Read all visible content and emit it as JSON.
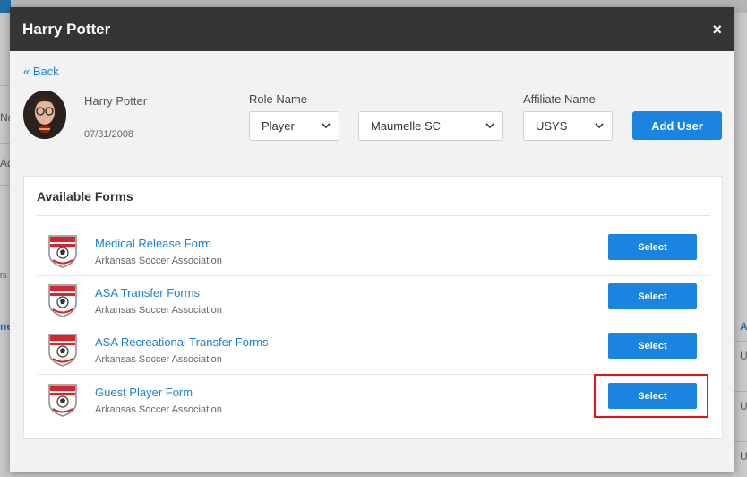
{
  "background_fragments": [
    "Na",
    "Ad",
    "rs",
    "ne",
    "A",
    "U",
    "U",
    "U"
  ],
  "modal": {
    "title": "Harry Potter",
    "close_icon": "×"
  },
  "back_link": "« Back",
  "user": {
    "name": "Harry Potter",
    "dob": "07/31/2008"
  },
  "fields": {
    "role_label": "Role Name",
    "role_value": "Player",
    "club_value": "Maumelle SC",
    "affiliate_label": "Affiliate Name",
    "affiliate_value": "USYS"
  },
  "add_user_label": "Add User",
  "forms": {
    "title": "Available Forms",
    "items": [
      {
        "name": "Medical Release Form",
        "org": "Arkansas Soccer Association",
        "button": "Select"
      },
      {
        "name": "ASA Transfer Forms",
        "org": "Arkansas Soccer Association",
        "button": "Select"
      },
      {
        "name": "ASA Recreational Transfer Forms",
        "org": "Arkansas Soccer Association",
        "button": "Select"
      },
      {
        "name": "Guest Player Form",
        "org": "Arkansas Soccer Association",
        "button": "Select"
      }
    ]
  },
  "colors": {
    "accent": "#1a85e0",
    "header": "#333537",
    "highlight": "#ee1111"
  }
}
